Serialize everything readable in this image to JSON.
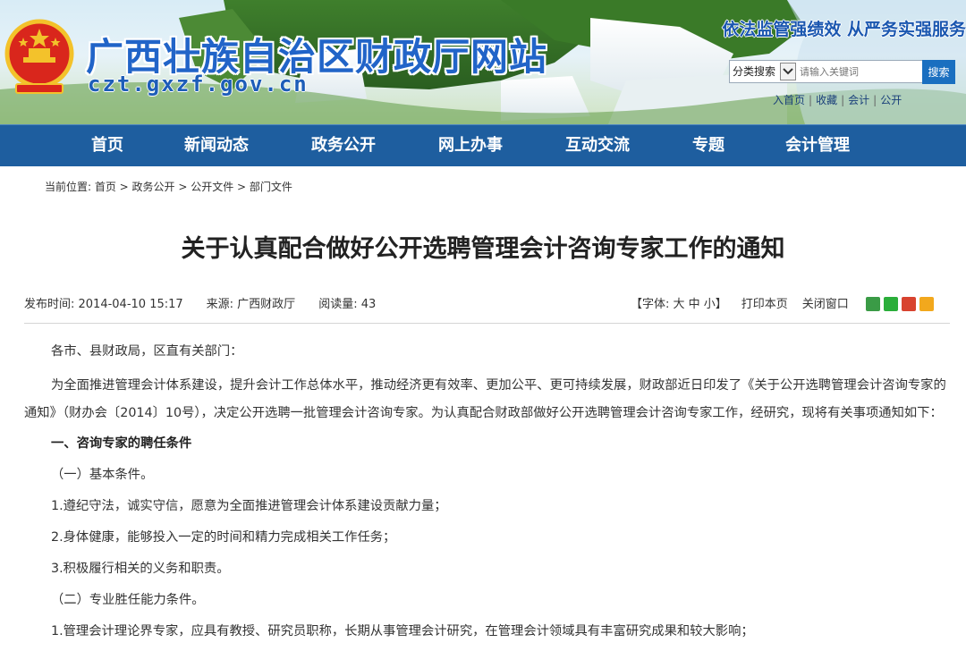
{
  "header": {
    "site_title": "广西壮族自治区财政厅网站",
    "domain": "czt.gxzf.gov.cn",
    "slogan": "依法监管强绩效  从严务实强服务",
    "search": {
      "type_label": "分类搜索",
      "placeholder": "请输入关键词",
      "button": "搜索"
    },
    "top_links": [
      "入首页",
      "收藏",
      "会计",
      "公开"
    ]
  },
  "nav": {
    "items": [
      "首页",
      "新闻动态",
      "政务公开",
      "网上办事",
      "互动交流",
      "专题",
      "会计管理"
    ]
  },
  "breadcrumb": "当前位置: 首页 > 政务公开 > 公开文件 > 部门文件",
  "article": {
    "title": "关于认真配合做好公开选聘管理会计咨询专家工作的通知",
    "publish_time": "发布时间: 2014-04-10 15:17",
    "source": "来源: 广西财政厅",
    "views": "阅读量: 43",
    "font_size_label": "【字体: 大 中 小】",
    "print_label": "打印本页",
    "close_label": "关闭窗口",
    "paragraphs": [
      "各市、县财政局，区直有关部门：",
      "为全面推进管理会计体系建设，提升会计工作总体水平，推动经济更有效率、更加公平、更可持续发展，财政部近日印发了《关于公开选聘管理会计咨询专家的通知》（财办会〔2014〕10号），决定公开选聘一批管理会计咨询专家。为认真配合财政部做好公开选聘管理会计咨询专家工作，经研究，现将有关事项通知如下：",
      "一、咨询专家的聘任条件",
      "（一）基本条件。",
      "1.遵纪守法，诚实守信，愿意为全面推进管理会计体系建设贡献力量；",
      "2.身体健康，能够投入一定的时间和精力完成相关工作任务；",
      "3.积极履行相关的义务和职责。",
      "（二）专业胜任能力条件。",
      "1.管理会计理论界专家，应具有教授、研究员职称，长期从事管理会计研究，在管理会计领域具有丰富研究成果和较大影响；"
    ]
  },
  "colors": {
    "nav_bg": "#1e5e9f",
    "title_blue": "#2164c8",
    "search_button": "#1a6fc0"
  }
}
